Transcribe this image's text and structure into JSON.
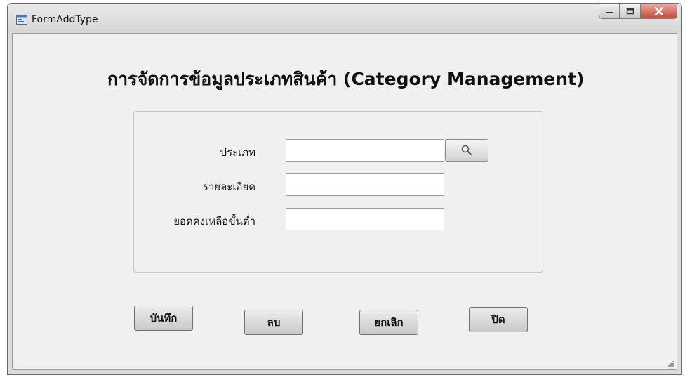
{
  "window": {
    "title": "FormAddType"
  },
  "form": {
    "heading": "การจัดการข้อมูลประเภทสินค้า (Category Management)",
    "fields": [
      {
        "label": "ประเภท",
        "value": ""
      },
      {
        "label": "รายละเอียด",
        "value": ""
      },
      {
        "label": "ยอดคงเหลือขั้นต่ำ",
        "value": ""
      }
    ]
  },
  "buttons": {
    "save": "บันทึก",
    "delete": "ลบ",
    "cancel": "ยกเลิก",
    "close": "ปิด"
  },
  "icons": {
    "search": "search-icon",
    "app": "form-icon"
  }
}
